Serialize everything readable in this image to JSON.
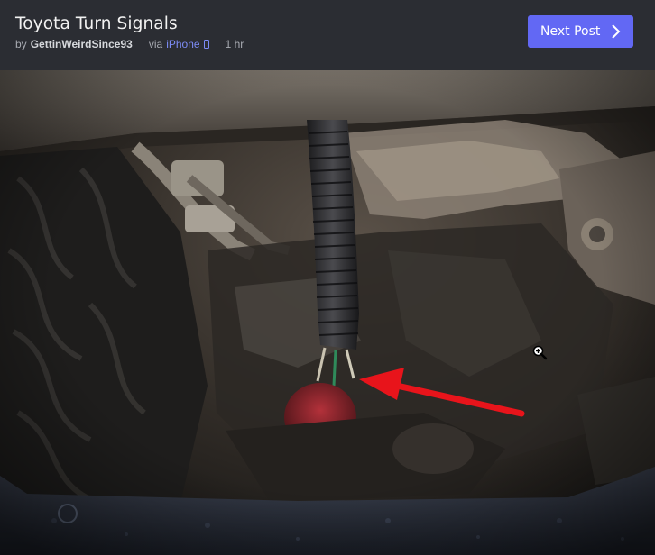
{
  "post": {
    "title": "Toyota Turn Signals",
    "by_label": "by",
    "author": "GettinWeirdSince93",
    "via_label": "via",
    "device": "iPhone",
    "device_icon": "phone-icon",
    "time_ago": "1 hr"
  },
  "nav": {
    "next_label": "Next Post",
    "next_icon": "chevron-right-icon"
  },
  "photo": {
    "annotation": "red-arrow",
    "cursor_icon": "zoom-in-icon"
  },
  "colors": {
    "accent": "#6268f4",
    "header_bg": "#2b2d33",
    "link": "#7d8cf6",
    "arrow": "#e8141b"
  }
}
